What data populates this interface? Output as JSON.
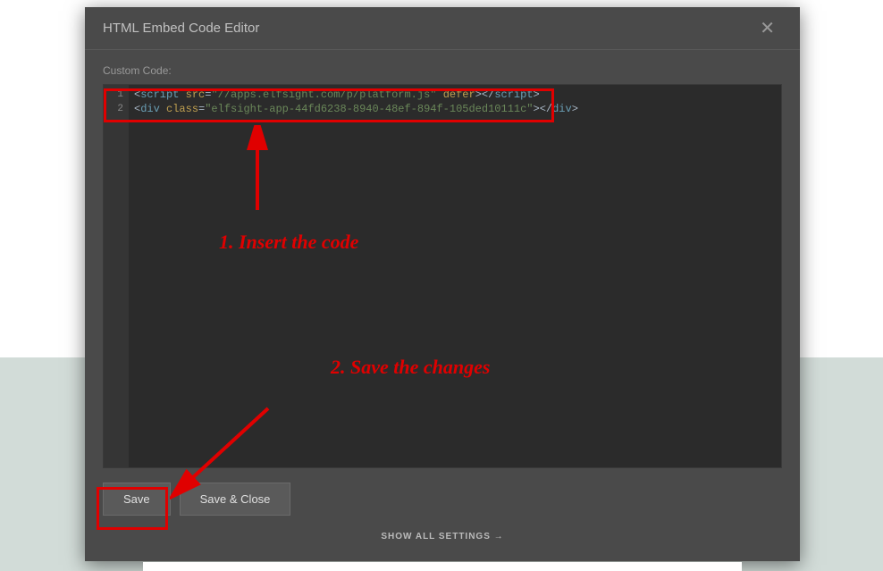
{
  "modal": {
    "title": "HTML Embed Code Editor",
    "label": "Custom Code:",
    "save_label": "Save",
    "save_close_label": "Save & Close",
    "show_all_label": "SHOW ALL SETTINGS →"
  },
  "code": {
    "line1_gutter": "1",
    "line2_gutter": "2",
    "script_tag": "script",
    "src_attr": "src",
    "src_value": "\"//apps.elfsight.com/p/platform.js\"",
    "defer_attr": "defer",
    "div_tag": "div",
    "class_attr": "class",
    "class_value": "\"elfsight-app-44fd6238-8940-48ef-894f-105ded10111c\""
  },
  "annotations": {
    "insert": "1. Insert the code",
    "save": "2. Save the changes"
  }
}
